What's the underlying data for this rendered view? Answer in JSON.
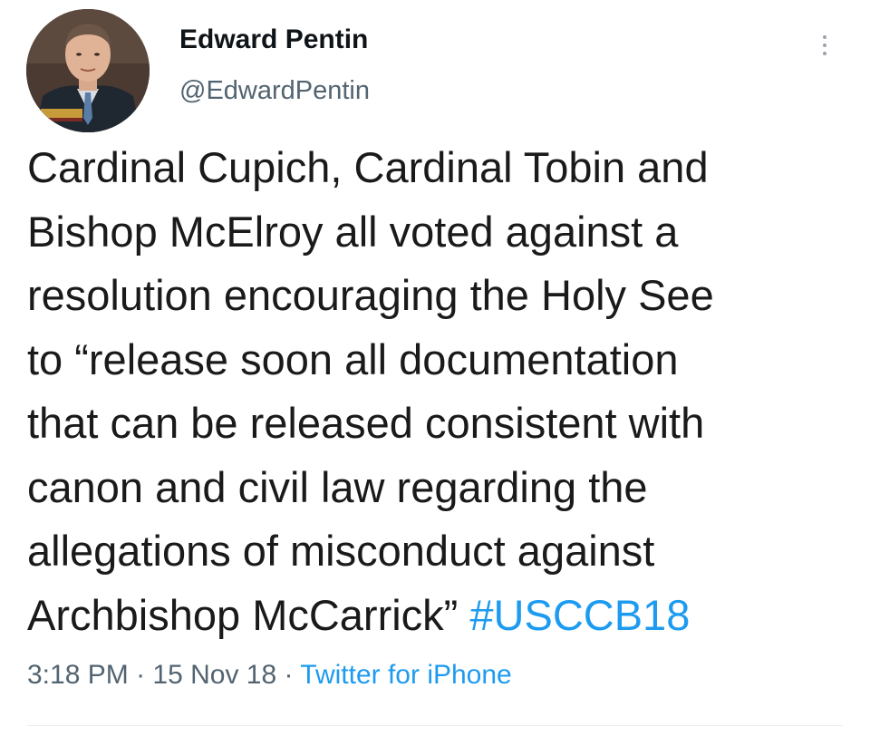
{
  "author": {
    "display_name": "Edward Pentin",
    "handle": "@EdwardPentin"
  },
  "tweet": {
    "lines": [
      "Cardinal Cupich, Cardinal Tobin and",
      "Bishop McElroy all voted against a",
      "resolution encouraging the Holy See",
      "to “release soon all documentation",
      "that can be released consistent with",
      "canon and civil law regarding the",
      "allegations of misconduct against"
    ],
    "last_line_text": "Archbishop McCarrick” ",
    "hashtag": "#USCCB18"
  },
  "meta": {
    "time": "3:18 PM",
    "separator": " · ",
    "date": "15 Nov 18",
    "source": "Twitter for iPhone"
  },
  "icons": {
    "more": "more-vertical-icon"
  },
  "colors": {
    "link": "#1d9bf0",
    "secondary_text": "#536471",
    "primary_text": "#1a1a1a"
  }
}
